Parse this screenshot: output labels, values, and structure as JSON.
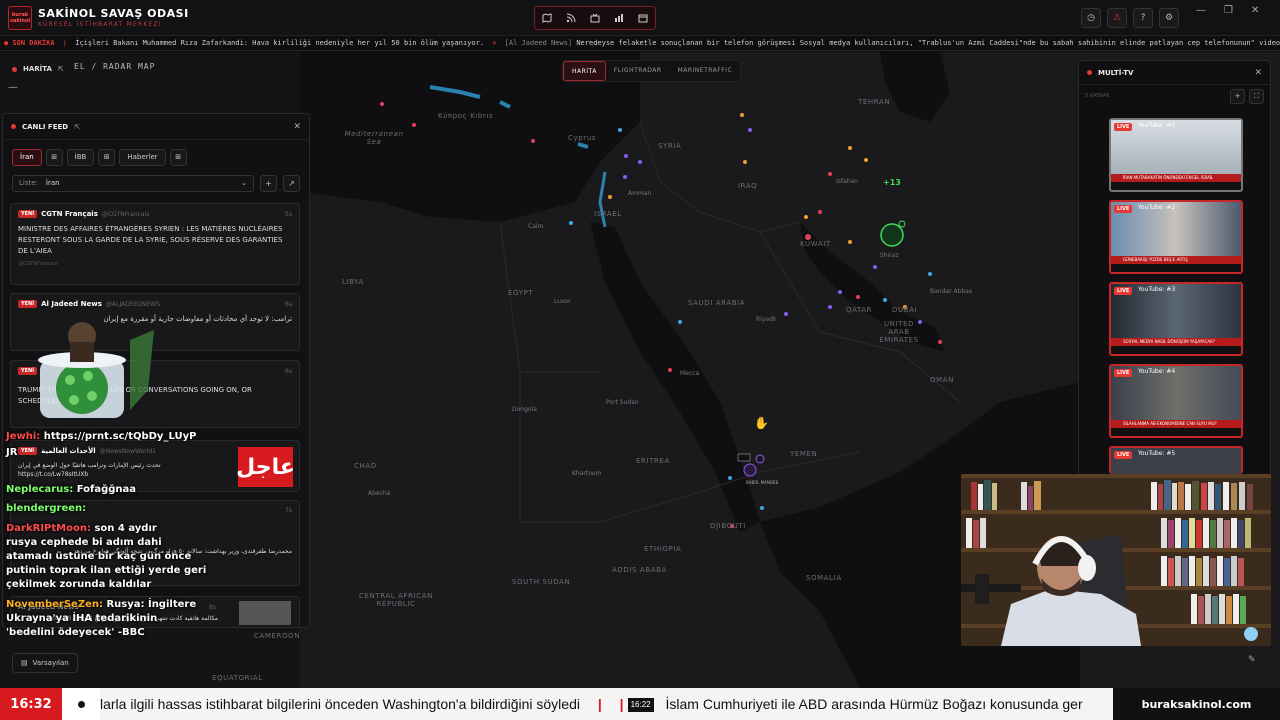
{
  "app": {
    "logo_text": "burak sakinol",
    "title": "SAKİNOL SAVAŞ ODASI",
    "subtitle": "KÜRESEL İSTİHBARAT MERKEZİ"
  },
  "top_tools": [
    "map-icon",
    "rss-icon",
    "tv-icon",
    "chart-icon",
    "calendar-icon"
  ],
  "top_right_tools": [
    "clock-icon",
    "alert-icon",
    "help-icon",
    "gear-icon"
  ],
  "window": {
    "minimize": "—",
    "restore": "❐",
    "close": "✕"
  },
  "ticker": {
    "live_label": "● SON DAKİKA",
    "items": [
      {
        "source": "",
        "text": "İçişleri Bakanı Muhammed Rıza Zafarkandi: Hava kirliliği nedeniyle her yıl 50 bin ölüm yaşanıyor."
      },
      {
        "source": "[Al Jadeed News]",
        "text": "Neredeyse felaketle sonuçlanan bir telefon görüşmesi Sosyal medya kullanıcıları, \"Trablus'un Azmi Caddesi\"nde bu sabah sahibinin elinde patlayan cep telefonunun\" video klibini paylaşarak bölgede paniğe yol"
      }
    ]
  },
  "map": {
    "panel_label": "HARİTA",
    "subtitle": "EL / RADAR MAP",
    "minus": "—",
    "tabs": [
      "HARİTA",
      "FLIGHTRADAR",
      "MARINETRAFFIC"
    ],
    "active_tab": "HARİTA",
    "cluster_count": "+13",
    "region_labels": [
      "SYRIA",
      "IRAQ",
      "SAUDI ARABIA",
      "EGYPT",
      "LIBYA",
      "YEMEN",
      "OMAN",
      "ERITREA",
      "ETHIOPIA",
      "SOUTH SUDAN",
      "CHAD",
      "SOMALIA",
      "CENTRAL AFRICAN REPUBLIC",
      "CAMEROON",
      "TEHRAN",
      "ISRAEL",
      "DJIBOUTI",
      "Mediterranean Sea",
      "UNITED ARAB EMIRATES",
      "DUBAI",
      "KUWAIT",
      "QATAR",
      "ADDIS ABABA",
      "EQUATORIAL",
      "Κύπρος Kıbrıs",
      "Cyprus"
    ],
    "city_labels": [
      "Amman",
      "Cairo",
      "Luxor",
      "Riyadh",
      "Mecca",
      "Port Sudan",
      "Dongola",
      "Khartoum",
      "Isfahan",
      "Abéché",
      "Shiraz",
      "Bandar Abbas"
    ],
    "marker_label": "BABÜL MANDEB",
    "defaults_button": "Varsayılan",
    "edit_icon": "pencil-icon"
  },
  "feed": {
    "title": "CANLI FEED",
    "tabs": [
      "İran",
      "⊞",
      "İBB",
      "⊞",
      "Haberler",
      "⊞"
    ],
    "list_label": "Liste:",
    "list_value": "İran",
    "items": [
      {
        "badge": "YENİ",
        "source": "CGTN Français",
        "handle": "@CGTNFrancais",
        "age": "5s",
        "text": "MINISTRE DES AFFAIRES ÉTRANGÈRES SYRIEN : LES MATIÈRES NUCLÉAIRES RESTERONT SOUS LA GARDE DE LA SYRIE, SOUS RÉSERVE DES GARANTIES DE L'AIEA",
        "sub": "@CGTNFrancais"
      },
      {
        "badge": "YENİ",
        "source": "Al Jadeed News",
        "handle": "@ALJADEEDNEWS",
        "age": "6s",
        "text": "ترامب: لا توجد أي محادثات أو مفاوضات جارية أو مقررة مع إيران",
        "sub": ""
      },
      {
        "badge": "YENİ",
        "source": "",
        "handle": "",
        "age": "6s",
        "text": "TRUMP: THERE ARE NO TALKS OR CONVERSATIONS GOING ON, OR SCHEDULED, WITH IRAN",
        "sub": ""
      },
      {
        "badge": "YENİ",
        "source": "الأحداث العالمية",
        "handle": "@NewsNowWorld1",
        "age": "7s",
        "text": "تحدث رئيس الإمارات وترامب هاتفيًا حول الوضع في إيران https://t.co/Lw78sItUXb",
        "sub": ""
      },
      {
        "badge": "",
        "source": "",
        "handle": "",
        "age": "7s",
        "text": "محمدرضا ظفرقندی، وزیر بهداشت: سالانه ۵۰ هزار مرگ در نتیجه آلودگی هوا رخ می‌دهد",
        "sub": ""
      },
      {
        "badge": "",
        "source": "Al Jadeed News",
        "handle": "",
        "age": "8s",
        "text": "مكالمة هاتفية كادت تنتهي بكارثة تداول رواد مواقع التواصل الاجتماعي",
        "sub": ""
      }
    ]
  },
  "chat": [
    {
      "user": "Jewhi:",
      "text": "https://prnt.sc/tQbDy_LUyP",
      "color": "#ff4c4c"
    },
    {
      "user": "JR",
      "text": "",
      "color": "#ffffff"
    },
    {
      "user": "Neplecarus:",
      "text": "Fofağğnaa",
      "color": "#7dff6a"
    },
    {
      "user": "blendergreen:",
      "text": "",
      "color": "#7dff6a"
    },
    {
      "user": "DarkRIPtMoon:",
      "text": "son 4 aydır",
      "color": "#ff4c4c"
    },
    {
      "user": "",
      "text": "rusya cephede bi adım dahi",
      "color": "#ffffff"
    },
    {
      "user": "",
      "text": "atamadı üstüne bir kaç gün önce",
      "color": "#ffffff"
    },
    {
      "user": "",
      "text": "putinin toprak ilan ettiği yerde geri",
      "color": "#ffffff"
    },
    {
      "user": "",
      "text": "çekilmek zorunda kaldılar",
      "color": "#ffffff"
    },
    {
      "user": "NovemberSeZen:",
      "text": "Rusya: İngiltere",
      "color": "#ffb020"
    },
    {
      "user": "",
      "text": "Ukrayna'ya İHA tedarikinin",
      "color": "#ffffff"
    },
    {
      "user": "",
      "text": "'bedelini ödeyecek' -BBC",
      "color": "#ffffff"
    }
  ],
  "ajel_text": "عاجل",
  "multitv": {
    "title": "MULTİ-TV",
    "sub": "5 KAYNAK",
    "live_label": "LIVE",
    "channels": [
      {
        "name": "YouTube: #1",
        "strap": "İRAN MUTABAKATIN ÖNÜNDEKİ ENGEL İSRAİL"
      },
      {
        "name": "YouTube: #2",
        "strap": "GÜNEBAKIŞI YÜZDE BEŞ'E ARTIŞ"
      },
      {
        "name": "YouTube: #3",
        "strap": "SOSYAL MEDYA NASIL DÖNÜŞÜM YAŞAYACAK?"
      },
      {
        "name": "YouTube: #4",
        "strap": "SİLAHLANMA AB EKONOMİSİNE CAN SUYU MU?"
      },
      {
        "name": "YouTube: #5",
        "strap": ""
      }
    ]
  },
  "bottom": {
    "clock": "16:32",
    "headline1": "larla ilgili hassas istihbarat bilgilerini önceden Washington'a bildirdiğini söyledi",
    "sep": "|",
    "time2": "16:22",
    "headline2": "İslam Cumhuriyeti ile ABD arasında Hürmüz Boğazı konusunda ger",
    "site": "buraksakinol.com"
  },
  "colors": {
    "accent": "#d71920",
    "cluster": "#3ddc5a",
    "coast": "#2f9fd6"
  }
}
